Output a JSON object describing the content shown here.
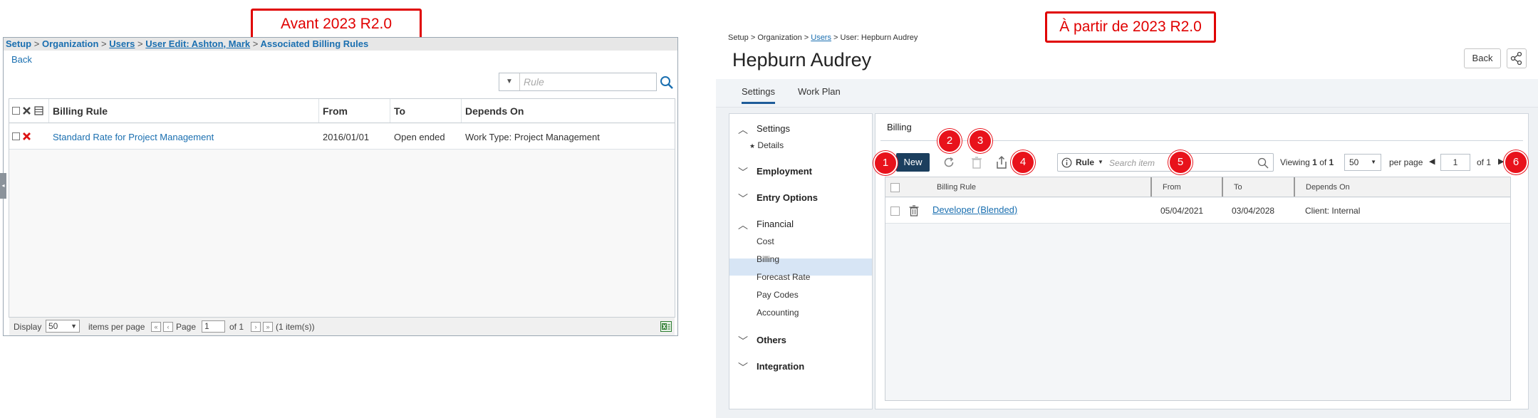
{
  "labels": {
    "before": "Avant 2023 R2.0",
    "after": "À partir de 2023 R2.0"
  },
  "old_ui": {
    "breadcrumb": {
      "setup": "Setup",
      "organization": "Organization",
      "users": "Users",
      "user_edit": "User Edit: Ashton, Mark",
      "current": "Associated Billing Rules",
      "separator": ">"
    },
    "back_label": "Back",
    "search": {
      "placeholder": "Rule"
    },
    "table": {
      "headers": [
        "Billing Rule",
        "From",
        "To",
        "Depends On"
      ],
      "rows": [
        {
          "billing_rule": "Standard Rate for Project Management",
          "from": "2016/01/01",
          "to": "Open ended",
          "depends_on": "Work Type: Project Management"
        }
      ]
    },
    "footer": {
      "display": "Display",
      "per_page_value": "50",
      "items_per_page": "items per page",
      "page": "Page",
      "page_value": "1",
      "of": "of 1",
      "items": "(1 item(s))"
    }
  },
  "new_ui": {
    "breadcrumb": {
      "setup": "Setup",
      "organization": "Organization",
      "users": "Users",
      "current": "User: Hepburn Audrey",
      "separator": ">"
    },
    "title": "Hepburn Audrey",
    "back_label": "Back",
    "tabs": [
      {
        "label": "Settings",
        "active": true
      },
      {
        "label": "Work Plan",
        "active": false
      }
    ],
    "nav": {
      "settings": "Settings",
      "details": "Details",
      "employment": "Employment",
      "entry_options": "Entry Options",
      "financial": "Financial",
      "financial_items": [
        "Cost",
        "Billing",
        "Forecast Rate",
        "Pay Codes",
        "Accounting"
      ],
      "others": "Others",
      "integration": "Integration"
    },
    "section_title": "Billing",
    "toolbar": {
      "new_label": "New",
      "search_field": "Rule",
      "search_placeholder": "Search item",
      "viewing": "Viewing",
      "viewing_start": "1",
      "viewing_of": "of",
      "viewing_total": "1",
      "per_page_value": "50",
      "per_page": "per page",
      "page_value": "1",
      "page_of": "of 1"
    },
    "grid": {
      "headers": [
        "Billing Rule",
        "From",
        "To",
        "Depends On"
      ],
      "rows": [
        {
          "billing_rule": "Developer (Blended)",
          "from": "05/04/2021",
          "to": "03/04/2028",
          "depends_on": "Client: Internal"
        }
      ]
    },
    "markers": [
      "1",
      "2",
      "3",
      "4",
      "5",
      "6"
    ]
  },
  "colors": {
    "annotation_red": "#e8121b",
    "link_blue": "#1a6fb0",
    "primary_button": "#1c3f5e",
    "nav_active": "#d7e5f5"
  }
}
